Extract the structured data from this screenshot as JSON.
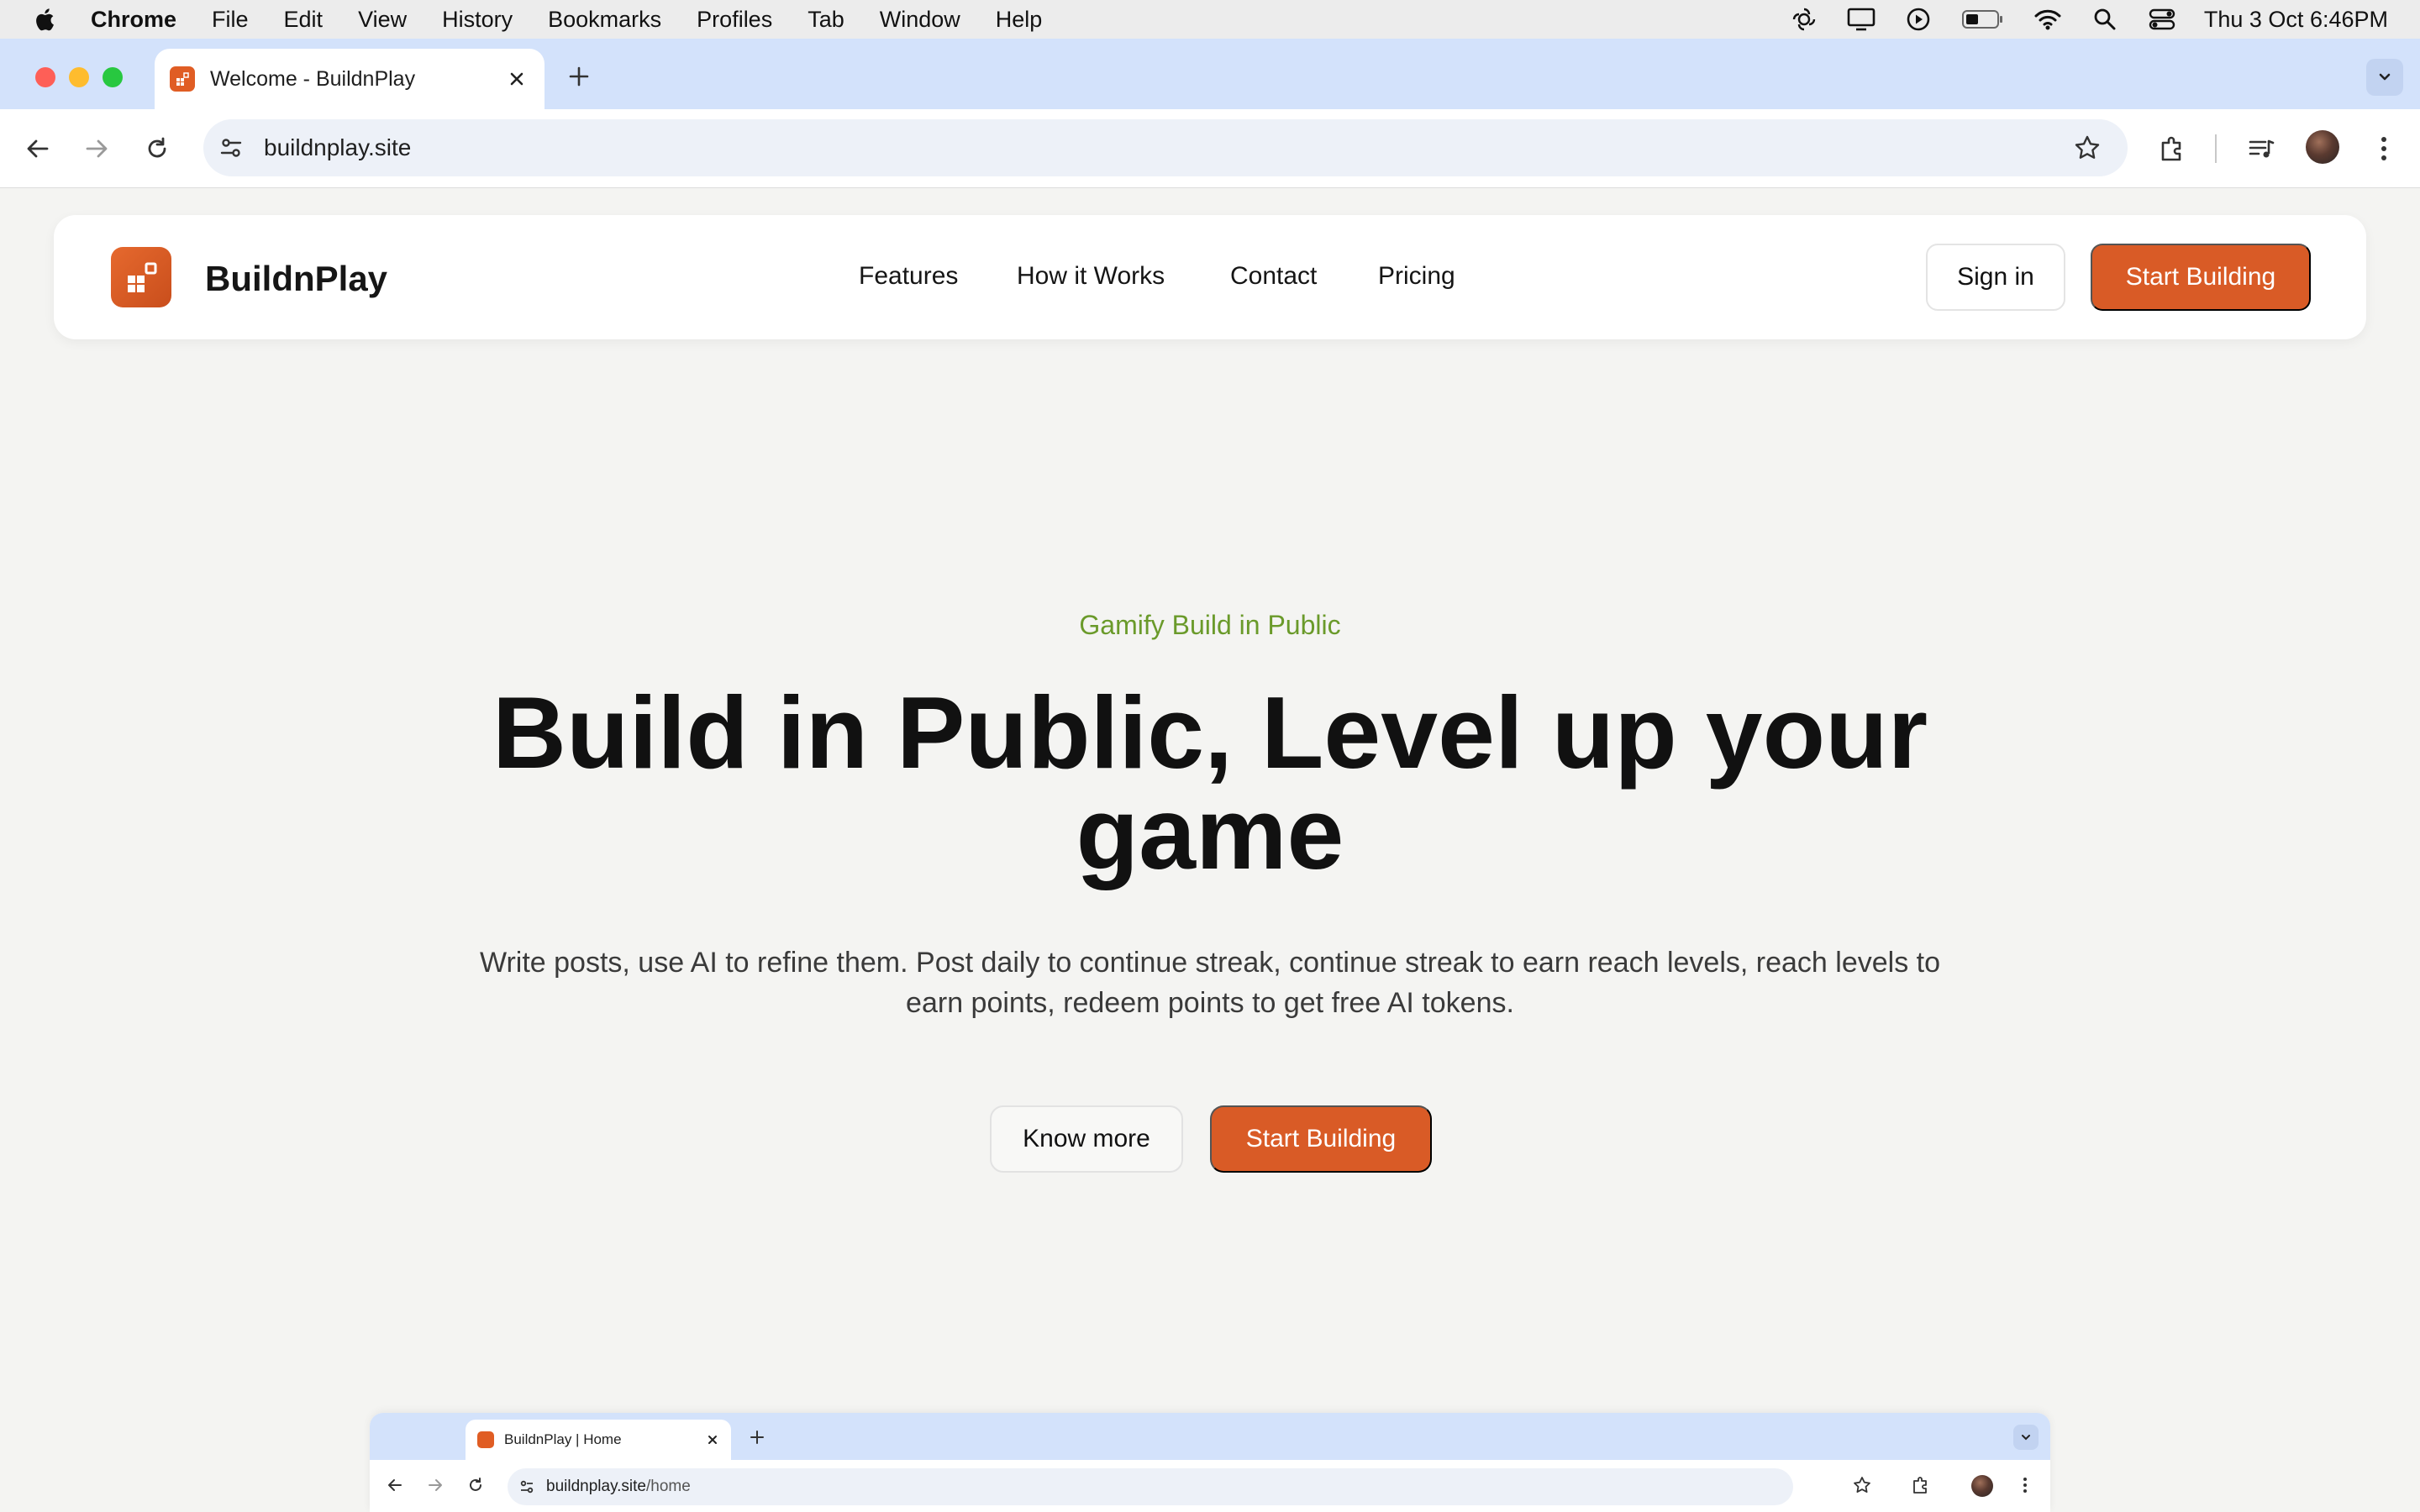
{
  "menubar": {
    "app_name": "Chrome",
    "items": [
      "File",
      "Edit",
      "View",
      "History",
      "Bookmarks",
      "Profiles",
      "Tab",
      "Window",
      "Help"
    ],
    "clock": "Thu 3 Oct  6:46PM"
  },
  "browser": {
    "tab_title": "Welcome - BuildnPlay",
    "url": "buildnplay.site"
  },
  "site": {
    "brand": "BuildnPlay",
    "nav": [
      "Features",
      "How it Works",
      "Contact",
      "Pricing"
    ],
    "signin_label": "Sign in",
    "start_label": "Start Building",
    "brand_color": "#d95b26"
  },
  "hero": {
    "eyebrow": "Gamify Build in Public",
    "title": "Build in Public, Level up your game",
    "subtitle": "Write posts, use AI to refine them. Post daily to continue streak, continue streak to earn reach levels, reach levels to earn points, redeem points to get free AI tokens.",
    "know_more_label": "Know more",
    "start_label": "Start Building",
    "eyebrow_color": "#6a9a2a"
  },
  "preview": {
    "tab_title": "BuildnPlay | Home",
    "url_domain": "buildnplay.site",
    "url_path": "/home"
  }
}
